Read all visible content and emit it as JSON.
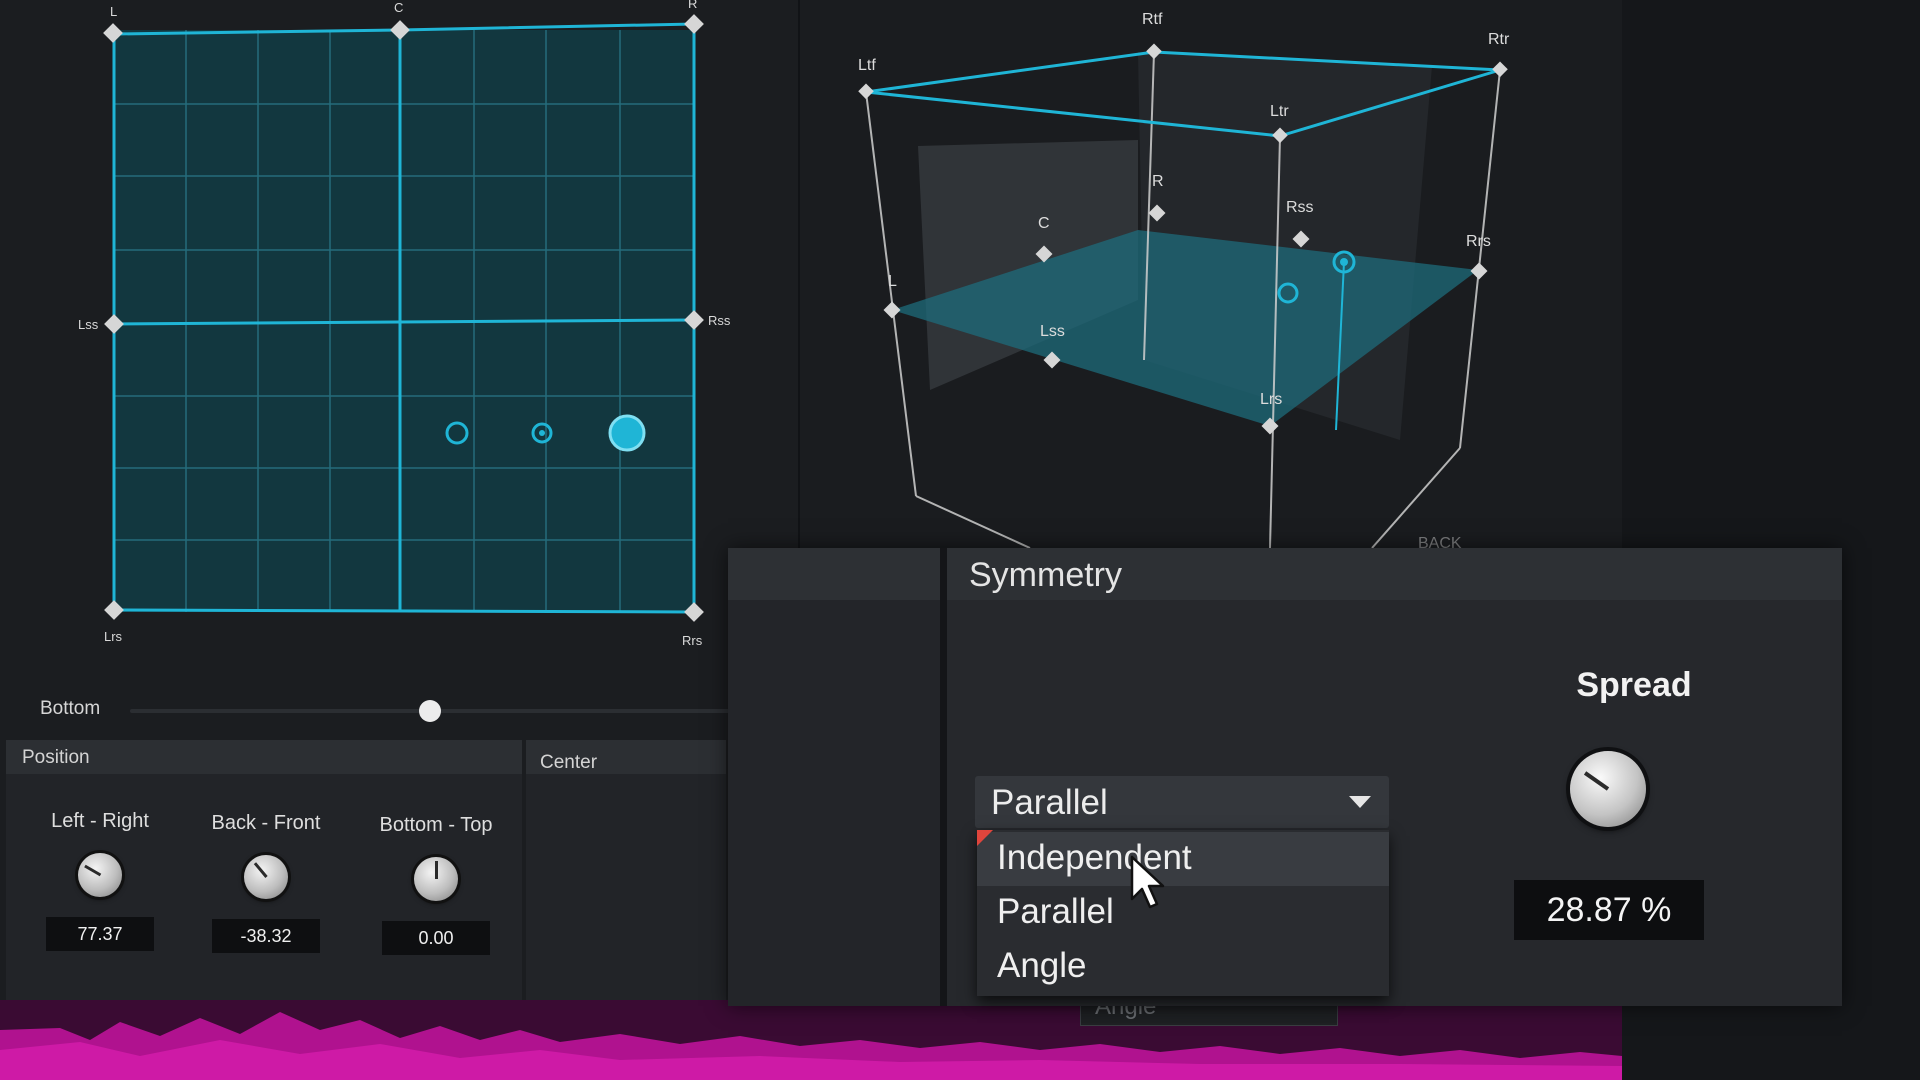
{
  "panner2d": {
    "channel_labels": {
      "L": "L",
      "C": "C",
      "R": "R",
      "Lss": "Lss",
      "Rss": "Rss",
      "Lrs": "Lrs",
      "Rrs": "Rrs"
    }
  },
  "panner3d": {
    "labels": {
      "Ltf": "Ltf",
      "Rtf": "Rtf",
      "Rtr": "Rtr",
      "Ltr": "Ltr",
      "C": "C",
      "R": "R",
      "Rss": "Rss",
      "Rrs": "Rrs",
      "L": "L",
      "Lss": "Lss",
      "Lrs": "Lrs",
      "back": "BACK"
    }
  },
  "bottom_slider": {
    "label": "Bottom",
    "value": 0.5
  },
  "position": {
    "title": "Position",
    "knobs": [
      {
        "label": "Left - Right",
        "value": "77.37"
      },
      {
        "label": "Back - Front",
        "value": "-38.32"
      },
      {
        "label": "Bottom - Top",
        "value": "0.00"
      }
    ]
  },
  "center": {
    "title": "Center"
  },
  "symmetry": {
    "title": "Symmetry",
    "dropdown": {
      "selected": "Parallel",
      "options": [
        "Independent",
        "Parallel",
        "Angle"
      ],
      "highlighted": "Independent"
    },
    "ghost_option": "Angle"
  },
  "spread": {
    "label": "Spread",
    "value": "28.87 %"
  },
  "colors": {
    "accent": "#1fb5d6",
    "grid_fill": "#12373f",
    "waveform": "#b0128f",
    "panel": "#26282c"
  }
}
